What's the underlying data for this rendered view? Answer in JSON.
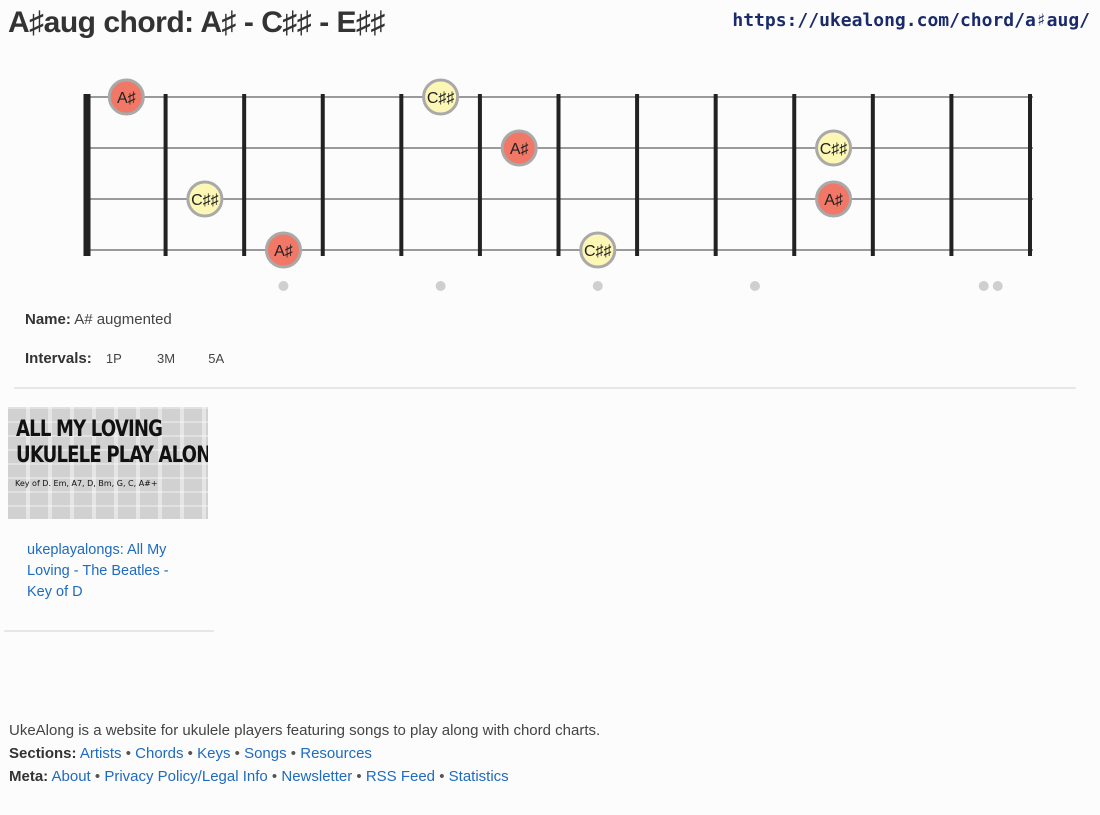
{
  "page": {
    "title": "A♯aug chord: A♯ - C♯♯ - E♯♯",
    "url": "https://ukealong.com/chord/a♯aug/"
  },
  "fretboard": {
    "strings": 4,
    "frets": 12,
    "note_colors": {
      "root": "#f17767",
      "third": "#fdf7b5",
      "ring": "#a9a9a9"
    },
    "notes": [
      {
        "string": 1,
        "fret": 1,
        "label": "A♯",
        "role": "root"
      },
      {
        "string": 1,
        "fret": 5,
        "label": "C♯♯",
        "role": "third"
      },
      {
        "string": 2,
        "fret": 6,
        "label": "A♯",
        "role": "root"
      },
      {
        "string": 2,
        "fret": 10,
        "label": "C♯♯",
        "role": "third"
      },
      {
        "string": 3,
        "fret": 2,
        "label": "C♯♯",
        "role": "third"
      },
      {
        "string": 3,
        "fret": 10,
        "label": "A♯",
        "role": "root"
      },
      {
        "string": 4,
        "fret": 3,
        "label": "A♯",
        "role": "root"
      },
      {
        "string": 4,
        "fret": 7,
        "label": "C♯♯",
        "role": "third"
      }
    ],
    "inlays": [
      {
        "fret": 3,
        "count": 1
      },
      {
        "fret": 5,
        "count": 1
      },
      {
        "fret": 7,
        "count": 1
      },
      {
        "fret": 9,
        "count": 1
      },
      {
        "fret": 12,
        "count": 2
      }
    ]
  },
  "info": {
    "name_label": "Name:",
    "name_value": "A# augmented",
    "intervals_label": "Intervals:",
    "intervals": [
      "1P",
      "3M",
      "5A"
    ]
  },
  "card": {
    "thumb_line1": "ALL MY LOVING",
    "thumb_line2": "UKULELE PLAY ALONG",
    "thumb_line3": "Key of D. Em, A7, D, Bm, G, C, A#+",
    "link_text": "ukeplayalongs: All My Loving - The Beatles - Key of D"
  },
  "footer": {
    "about_text": "UkeAlong is a website for ukulele players featuring songs to play along with chord charts.",
    "sections_label": "Sections:",
    "sections": [
      "Artists",
      "Chords",
      "Keys",
      "Songs",
      "Resources"
    ],
    "meta_label": "Meta:",
    "meta": [
      "About",
      "Privacy Policy/Legal Info",
      "Newsletter",
      "RSS Feed",
      "Statistics"
    ]
  }
}
